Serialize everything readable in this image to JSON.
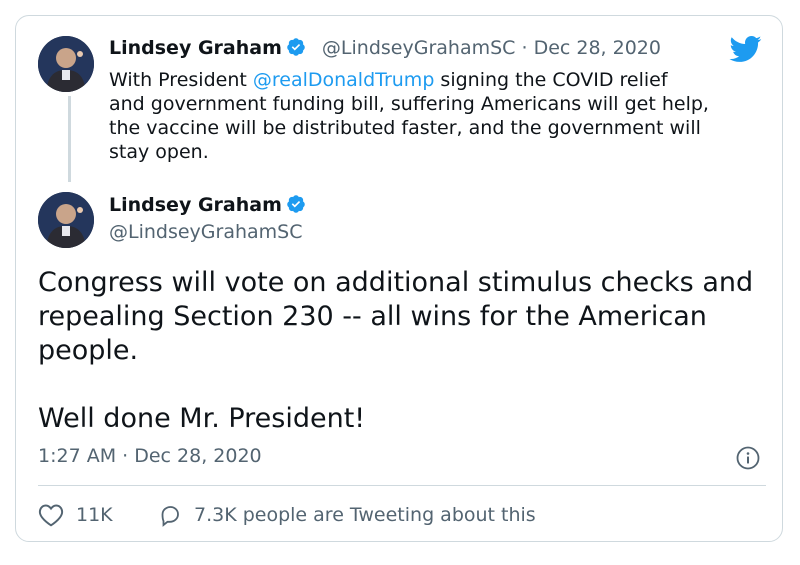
{
  "reply": {
    "author_name": "Lindsey Graham",
    "handle": "@LindseyGrahamSC",
    "separator": "·",
    "date": "Dec 28, 2020",
    "text_before": "With President ",
    "mention": "@realDonaldTrump",
    "text_after": " signing the COVID relief and government funding bill, suffering Americans will get help, the vaccine will be distributed faster, and the government will stay open."
  },
  "main": {
    "author_name": "Lindsey Graham",
    "handle": "@LindseyGrahamSC",
    "text": "Congress will vote on additional stimulus checks and repealing Section 230 -- all wins for the American people.\n\nWell done Mr. President!",
    "timestamp": "1:27 AM · Dec 28, 2020"
  },
  "actions": {
    "likes": "11K",
    "tweeting": "7.3K people are Tweeting about this"
  },
  "icons": {
    "brand": "twitter-bird-icon",
    "verified": "verified-badge-icon",
    "info": "info-icon",
    "like": "heart-icon",
    "reply": "speech-bubble-icon"
  },
  "colors": {
    "accent": "#1d9bf0",
    "text": "#0f1419",
    "secondary": "#536471",
    "border": "#cfd9de"
  }
}
